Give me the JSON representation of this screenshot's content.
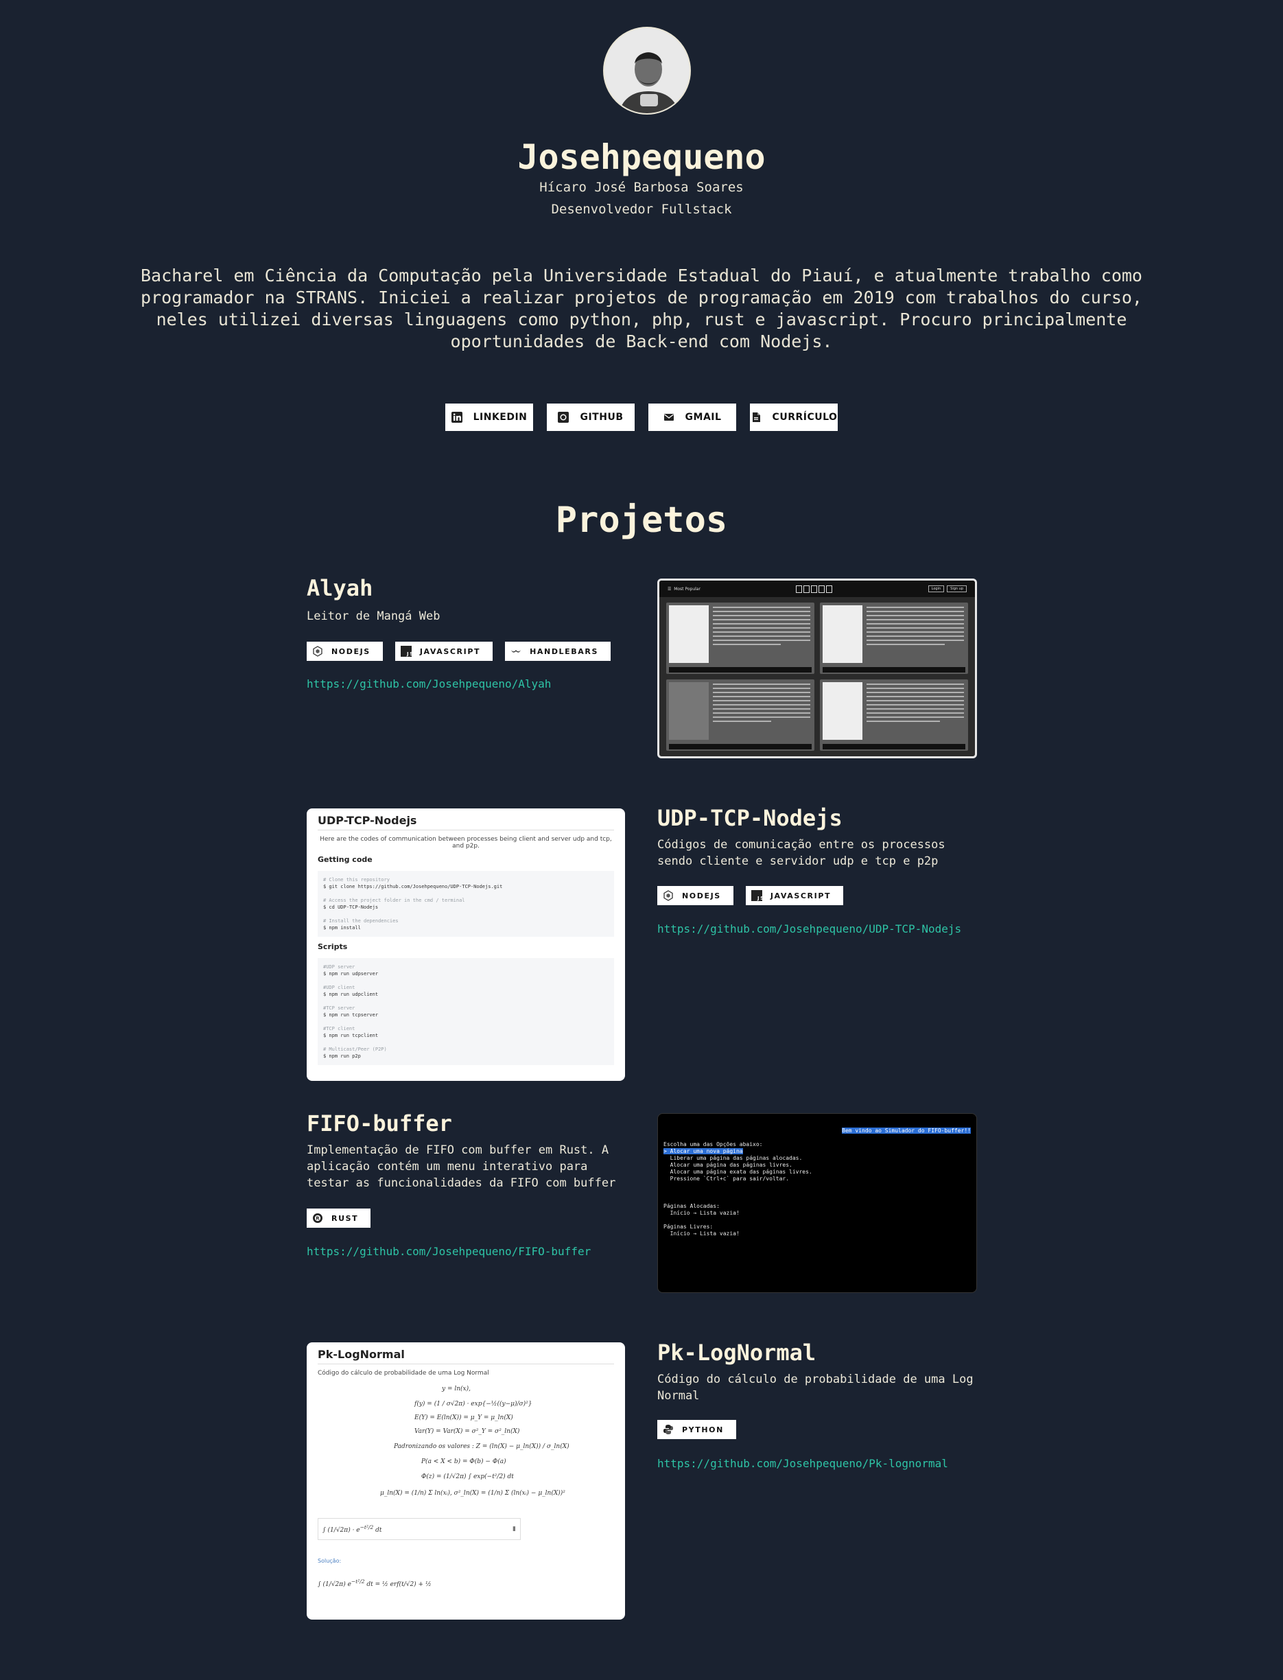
{
  "profile": {
    "username": "Josehpequeno",
    "full_name": "Hícaro José Barbosa Soares",
    "role": "Desenvolvedor Fullstack",
    "bio": "Bacharel em Ciência da Computação pela Universidade Estadual do Piauí, e atualmente trabalho como programador na STRANS. Iniciei a realizar projetos de programação em 2019 com trabalhos do curso, neles utilizei diversas linguagens como python, php, rust e javascript. Procuro principalmente oportunidades de Back-end com Nodejs."
  },
  "social": [
    {
      "label": "LINKEDIN",
      "icon": "linkedin-icon"
    },
    {
      "label": "GITHUB",
      "icon": "github-icon"
    },
    {
      "label": "GMAIL",
      "icon": "mail-icon"
    },
    {
      "label": "CURRÍCULO",
      "icon": "pdf-icon"
    }
  ],
  "projects_section": {
    "title": "Projetos",
    "items": [
      {
        "title": "Alyah",
        "description": "Leitor de Mangá Web",
        "tags": [
          "NODEJS",
          "JAVASCRIPT",
          "HANDLEBARS"
        ],
        "link": "https://github.com/Josehpequeno/Alyah"
      },
      {
        "title": "UDP-TCP-Nodejs",
        "description": "Códigos de comunicação entre os processos sendo cliente e servidor udp e tcp e p2p",
        "tags": [
          "NODEJS",
          "JAVASCRIPT"
        ],
        "link": "https://github.com/Josehpequeno/UDP-TCP-Nodejs"
      },
      {
        "title": "FIFO-buffer",
        "description": "Implementação de FIFO com buffer em Rust. A aplicação contém um menu interativo para testar as funcionalidades da FIFO com buffer",
        "tags": [
          "RUST"
        ],
        "link": "https://github.com/Josehpequeno/FIFO-buffer"
      },
      {
        "title": "Pk-LogNormal",
        "description": "Código do cálculo de probabilidade de uma Log Normal",
        "tags": [
          "PYTHON"
        ],
        "link": "https://github.com/Josehpequeno/Pk-lognormal"
      }
    ]
  },
  "screenshots": {
    "alyah": {
      "nav_text": "Most Popular",
      "login": "Login",
      "signup": "Sign up"
    },
    "udp": {
      "heading": "UDP-TCP-Nodejs",
      "intro": "Here are the codes of communication between processes being client and server udp and tcp, and p2p.",
      "getting_started": "Getting code",
      "scripts": "Scripts",
      "code1": [
        "# Clone this repository",
        "$ git clone https://github.com/Josehpequeno/UDP-TCP-Nodejs.git",
        "",
        "# Access the project folder in the cmd / terminal",
        "$ cd UDP-TCP-Nodejs",
        "",
        "# Install the dependencies",
        "$ npm install"
      ],
      "code2": [
        "#UDP server",
        "$ npm run udpserver",
        "",
        "#UDP client",
        "$ npm run udpclient",
        "",
        "#TCP server",
        "$ npm run tcpserver",
        "",
        "#TCP client",
        "$ npm run tcpclient",
        "",
        "# Multicast/Peer (P2P)",
        "$ npm run p2p"
      ]
    },
    "fifo": {
      "banner": "Bem vindo ao Simulador do FIFO-buffer!!",
      "lines": [
        "Escolha uma das Opções abaixo:",
        "> Alocar uma nova página",
        "  Liberar uma página das páginas alocadas.",
        "  Alocar uma página das páginas livres.",
        "  Alocar uma página exata das páginas livres.",
        "  Pressione `Ctrl+c` para sair/voltar.",
        "",
        "",
        "Páginas Alocadas:",
        "  Início → Lista vazia!",
        "",
        "Páginas Livres:",
        "  Início → Lista vazia!"
      ]
    },
    "pk": {
      "heading": "Pk-LogNormal",
      "intro": "Código do cálculo de probabilidade de uma Log Normal",
      "solution_label": "Solução:"
    }
  }
}
